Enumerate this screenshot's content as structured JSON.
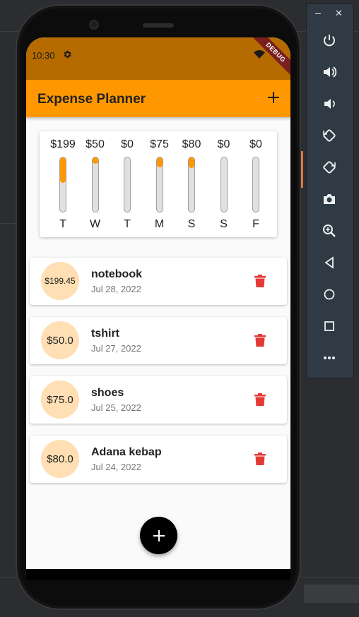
{
  "status_bar": {
    "time": "10:30",
    "debug_banner": "DEBUG"
  },
  "app_bar": {
    "title": "Expense Planner",
    "add_icon": "plus-icon"
  },
  "chart": {
    "days": [
      {
        "amount": "$199",
        "day": "T",
        "fill": 0.47
      },
      {
        "amount": "$50",
        "day": "W",
        "fill": 0.12
      },
      {
        "amount": "$0",
        "day": "T",
        "fill": 0
      },
      {
        "amount": "$75",
        "day": "M",
        "fill": 0.18
      },
      {
        "amount": "$80",
        "day": "S",
        "fill": 0.2
      },
      {
        "amount": "$0",
        "day": "S",
        "fill": 0
      },
      {
        "amount": "$0",
        "day": "F",
        "fill": 0
      }
    ]
  },
  "transactions": [
    {
      "amount": "$199.45",
      "title": "notebook",
      "date": "Jul 28, 2022"
    },
    {
      "amount": "$50.0",
      "title": "tshirt",
      "date": "Jul 27, 2022"
    },
    {
      "amount": "$75.0",
      "title": "shoes",
      "date": "Jul 25, 2022"
    },
    {
      "amount": "$80.0",
      "title": "Adana kebap",
      "date": "Jul 24, 2022"
    }
  ],
  "colors": {
    "primary": "#ff9800",
    "status_bar": "#b66b00",
    "delete": "#e53935",
    "avatar": "#ffdfb3"
  },
  "emulator_panel": {
    "window_icons": [
      "minimize-icon",
      "close-icon"
    ],
    "buttons": [
      "power-icon",
      "volume-up-icon",
      "volume-down-icon",
      "rotate-left-icon",
      "rotate-right-icon",
      "camera-icon",
      "zoom-icon",
      "back-icon",
      "home-icon",
      "overview-icon",
      "more-icon"
    ]
  }
}
